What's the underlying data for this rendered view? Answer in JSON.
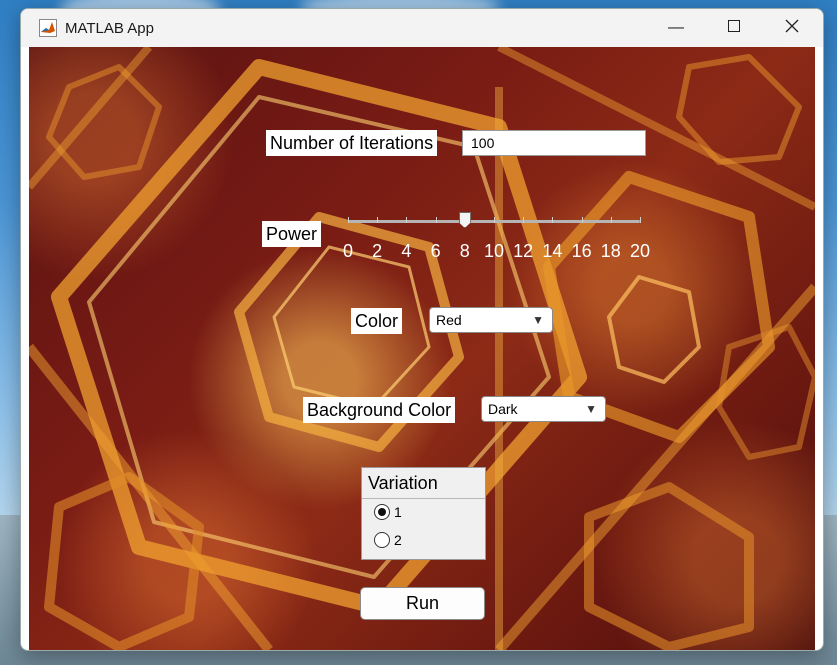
{
  "window": {
    "title": "MATLAB App",
    "minimize_icon": "minimize-icon",
    "maximize_icon": "maximize-icon",
    "close_icon": "close-icon",
    "app_icon": "matlab-logo-icon"
  },
  "iterations": {
    "label": "Number of Iterations",
    "value": "100"
  },
  "power": {
    "label": "Power",
    "value": 8,
    "min": 0,
    "max": 20,
    "ticks": [
      "0",
      "2",
      "4",
      "6",
      "8",
      "10",
      "12",
      "14",
      "16",
      "18",
      "20"
    ]
  },
  "color": {
    "label": "Color",
    "selected": "Red"
  },
  "background_color": {
    "label": "Background Color",
    "selected": "Dark"
  },
  "variation": {
    "title": "Variation",
    "options": [
      "1",
      "2"
    ],
    "selected_index": 0
  },
  "run_button": {
    "label": "Run"
  },
  "colors": {
    "accent": "#f5b02e",
    "background": "#6a1810"
  }
}
